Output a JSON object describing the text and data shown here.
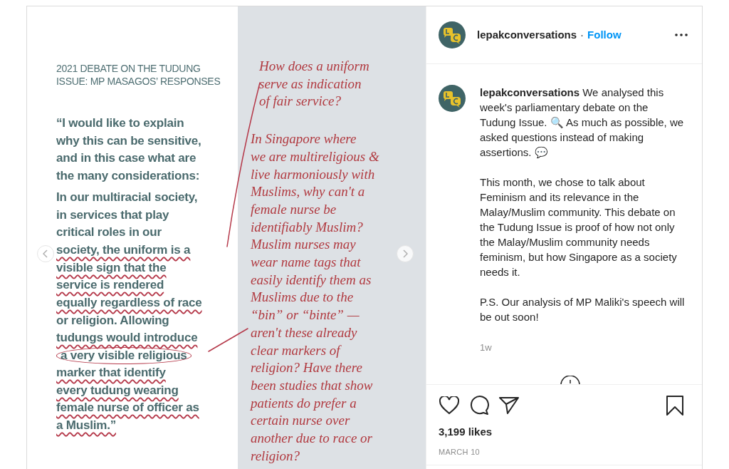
{
  "slide": {
    "heading": [
      "2021 DEBATE ON THE TUDUNG",
      "ISSUE: MP MASAGOS’ RESPONSES"
    ],
    "quote": [
      [
        {
          "text": "“I would like to explain",
          "underlined": false,
          "circled": false
        },
        {
          "text": "why this can be sensitive,",
          "underlined": false,
          "circled": false
        },
        {
          "text": "and in this case what are",
          "underlined": false,
          "circled": false
        },
        {
          "text": "the many considerations:",
          "underlined": false,
          "circled": false
        }
      ],
      [
        {
          "text": "In our multiracial society,",
          "underlined": false,
          "circled": false
        },
        {
          "text": "in services that play",
          "underlined": false,
          "circled": false
        },
        {
          "text": "critical roles in our",
          "underlined": false,
          "circled": false
        },
        {
          "text": "society, the uniform is a",
          "underlined": true,
          "circled": false
        },
        {
          "text": "visible sign that the",
          "underlined": true,
          "circled": false
        },
        {
          "text": "service is rendered",
          "underlined": true,
          "circled": false
        },
        {
          "text": "equally regardless of race",
          "underlined": true,
          "circled": false
        },
        {
          "text": "or religion. Allowing",
          "underlined": false,
          "circled": false
        },
        {
          "text": "tudungs would introduce",
          "underlined": true,
          "circled": false
        },
        {
          "text": "a very visible religious",
          "underlined": false,
          "circled": true
        },
        {
          "text": "marker that identify",
          "underlined": true,
          "circled": false
        },
        {
          "text": "every tudung wearing",
          "underlined": true,
          "circled": false
        },
        {
          "text": "female nurse of officer as",
          "underlined": true,
          "circled": false
        },
        {
          "text": "a Muslim.”",
          "underlined": true,
          "circled": false
        }
      ]
    ],
    "notes": [
      [
        "How does a uniform",
        "serve as indication",
        "of fair service?"
      ],
      [
        "In Singapore where",
        "we are multireligious &",
        "live harmoniously with",
        "Muslims, why can't a",
        "female nurse be",
        "identifiably Muslim?",
        "Muslim nurses may",
        "wear name tags that",
        "easily identify them as",
        "Muslims due to the",
        "“bin” or “binte” —",
        "aren't these already",
        "clear markers of",
        "religion? Have there",
        "been studies that show",
        "patients do prefer a",
        "certain nurse over",
        "another due to race or",
        "religion?"
      ]
    ]
  },
  "header": {
    "username": "lepakconversations",
    "separator": "·",
    "follow": "Follow"
  },
  "caption": {
    "paragraphs": [
      "**lepakconversations** We analysed this week's parliamentary debate on the Tudung Issue. 🔍 As much as possible, we asked questions instead of making assertions. 💬",
      "This month, we chose to talk about Feminism and its relevance in the Malay/Muslim community. This debate on the Tudung Issue is proof of how not only the Malay/Muslim community needs feminism, but how Singapore as a society needs it.",
      "P.S. Our analysis of MP Maliki's speech will be out soon!"
    ],
    "time": "1w"
  },
  "likes": "3,199 likes",
  "date": "MARCH 10"
}
